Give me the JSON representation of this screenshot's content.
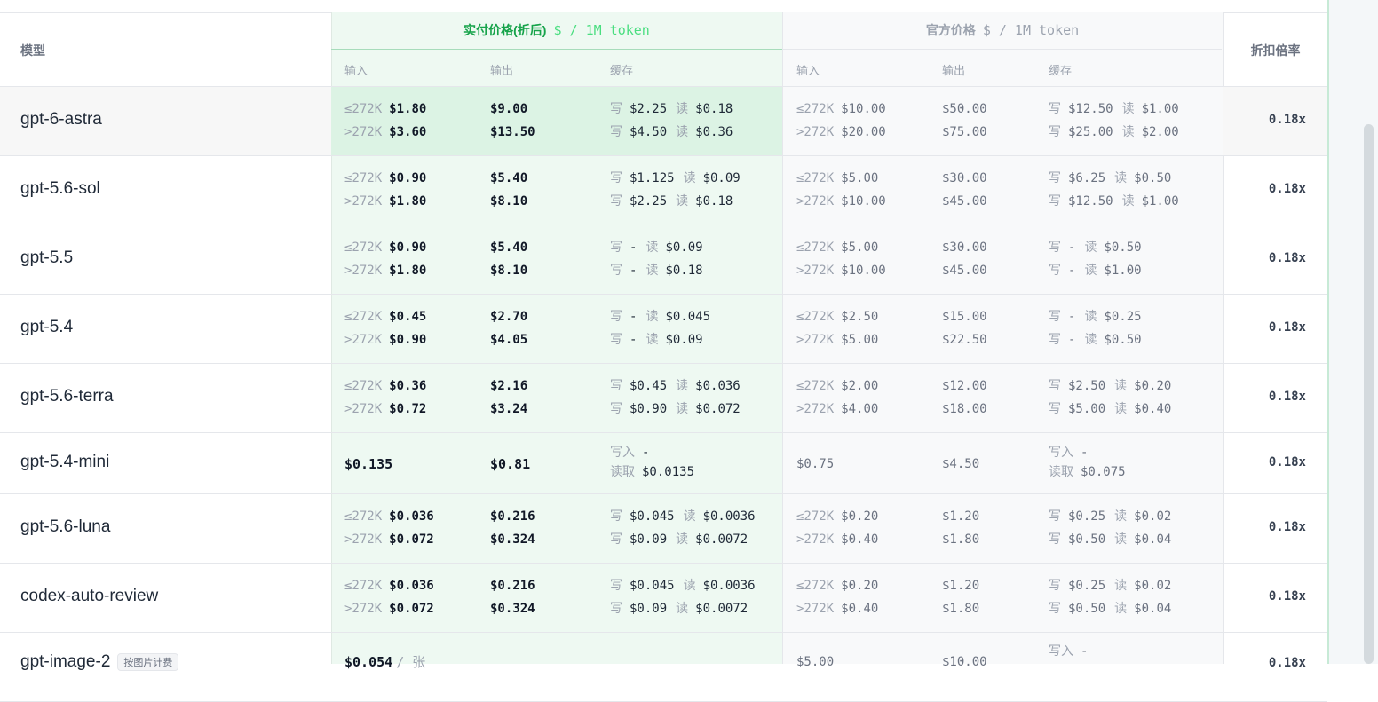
{
  "header": {
    "model": "模型",
    "actual_title": "实付价格(折后)",
    "actual_unit": "$ / 1M token",
    "official_title": "官方价格",
    "official_unit": "$ / 1M token",
    "input": "输入",
    "output": "输出",
    "cache": "缓存",
    "rate": "折扣倍率"
  },
  "labels": {
    "le": "≤272K",
    "gt": ">272K",
    "write": "写",
    "read": "读",
    "write_full": "写入",
    "read_full": "读取",
    "dash": "-",
    "per_image": "/ 张"
  },
  "rows": [
    {
      "model": "gpt-6-astra",
      "a_in": [
        "$1.80",
        "$3.60"
      ],
      "a_out": [
        "$9.00",
        "$13.50"
      ],
      "a_cw": [
        "$2.25",
        "$4.50"
      ],
      "a_cr": [
        "$0.18",
        "$0.36"
      ],
      "o_in": [
        "$10.00",
        "$20.00"
      ],
      "o_out": [
        "$50.00",
        "$75.00"
      ],
      "o_cw": [
        "$12.50",
        "$25.00"
      ],
      "o_cr": [
        "$1.00",
        "$2.00"
      ],
      "rate": "0.18x"
    },
    {
      "model": "gpt-5.6-sol",
      "a_in": [
        "$0.90",
        "$1.80"
      ],
      "a_out": [
        "$5.40",
        "$8.10"
      ],
      "a_cw": [
        "$1.125",
        "$2.25"
      ],
      "a_cr": [
        "$0.09",
        "$0.18"
      ],
      "o_in": [
        "$5.00",
        "$10.00"
      ],
      "o_out": [
        "$30.00",
        "$45.00"
      ],
      "o_cw": [
        "$6.25",
        "$12.50"
      ],
      "o_cr": [
        "$0.50",
        "$1.00"
      ],
      "rate": "0.18x"
    },
    {
      "model": "gpt-5.5",
      "a_in": [
        "$0.90",
        "$1.80"
      ],
      "a_out": [
        "$5.40",
        "$8.10"
      ],
      "a_cw": [
        "-",
        "-"
      ],
      "a_cr": [
        "$0.09",
        "$0.18"
      ],
      "o_in": [
        "$5.00",
        "$10.00"
      ],
      "o_out": [
        "$30.00",
        "$45.00"
      ],
      "o_cw": [
        "-",
        "-"
      ],
      "o_cr": [
        "$0.50",
        "$1.00"
      ],
      "rate": "0.18x"
    },
    {
      "model": "gpt-5.4",
      "a_in": [
        "$0.45",
        "$0.90"
      ],
      "a_out": [
        "$2.70",
        "$4.05"
      ],
      "a_cw": [
        "-",
        "-"
      ],
      "a_cr": [
        "$0.045",
        "$0.09"
      ],
      "o_in": [
        "$2.50",
        "$5.00"
      ],
      "o_out": [
        "$15.00",
        "$22.50"
      ],
      "o_cw": [
        "-",
        "-"
      ],
      "o_cr": [
        "$0.25",
        "$0.50"
      ],
      "rate": "0.18x"
    },
    {
      "model": "gpt-5.6-terra",
      "a_in": [
        "$0.36",
        "$0.72"
      ],
      "a_out": [
        "$2.16",
        "$3.24"
      ],
      "a_cw": [
        "$0.45",
        "$0.90"
      ],
      "a_cr": [
        "$0.036",
        "$0.072"
      ],
      "o_in": [
        "$2.00",
        "$4.00"
      ],
      "o_out": [
        "$12.00",
        "$18.00"
      ],
      "o_cw": [
        "$2.50",
        "$5.00"
      ],
      "o_cr": [
        "$0.20",
        "$0.40"
      ],
      "rate": "0.18x"
    },
    {
      "model": "gpt-5.4-mini",
      "single": true,
      "a_in1": "$0.135",
      "a_out1": "$0.81",
      "a_cw1": "-",
      "a_cr1": "$0.0135",
      "o_in1": "$0.75",
      "o_out1": "$4.50",
      "o_cw1": "-",
      "o_cr1": "$0.075",
      "rate": "0.18x"
    },
    {
      "model": "gpt-5.6-luna",
      "a_in": [
        "$0.036",
        "$0.072"
      ],
      "a_out": [
        "$0.216",
        "$0.324"
      ],
      "a_cw": [
        "$0.045",
        "$0.09"
      ],
      "a_cr": [
        "$0.0036",
        "$0.0072"
      ],
      "o_in": [
        "$0.20",
        "$0.40"
      ],
      "o_out": [
        "$1.20",
        "$1.80"
      ],
      "o_cw": [
        "$0.25",
        "$0.50"
      ],
      "o_cr": [
        "$0.02",
        "$0.04"
      ],
      "rate": "0.18x"
    },
    {
      "model": "codex-auto-review",
      "a_in": [
        "$0.036",
        "$0.072"
      ],
      "a_out": [
        "$0.216",
        "$0.324"
      ],
      "a_cw": [
        "$0.045",
        "$0.09"
      ],
      "a_cr": [
        "$0.0036",
        "$0.0072"
      ],
      "o_in": [
        "$0.20",
        "$0.40"
      ],
      "o_out": [
        "$1.20",
        "$1.80"
      ],
      "o_cw": [
        "$0.25",
        "$0.50"
      ],
      "o_cr": [
        "$0.02",
        "$0.04"
      ],
      "rate": "0.18x"
    },
    {
      "model": "gpt-image-2",
      "badge": "按图片计费",
      "partial": true,
      "a_in1": "$0.054",
      "o_in1": "$5.00",
      "o_out1": "$10.00",
      "o_cw1": "-",
      "rate": "0.18x"
    }
  ]
}
